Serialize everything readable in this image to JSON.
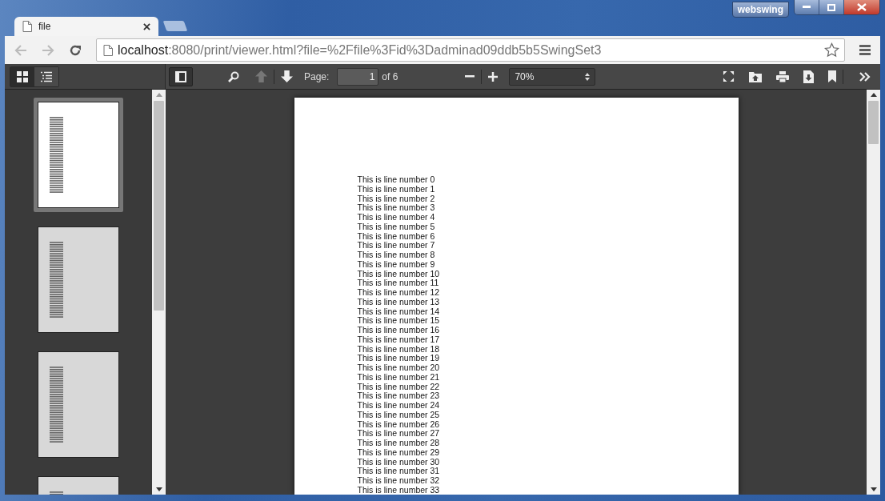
{
  "browser": {
    "tab_title": "file",
    "url_host": "localhost",
    "url_rest": ":8080/print/viewer.html?file=%2Ffile%3Fid%3Dadminad09ddb5b5SwingSet3",
    "user_badge": "webswing"
  },
  "sidebar_views": [
    {
      "kind": "thumbnails",
      "selected": true
    },
    {
      "kind": "outline",
      "selected": false
    }
  ],
  "toolbar": {
    "prev_disabled": true,
    "next_disabled": false,
    "page_label": "Page:",
    "page_value": "1",
    "page_count": "of 6",
    "zoom": "70%"
  },
  "thumbnails": [
    {
      "selected": true
    },
    {
      "selected": false
    },
    {
      "selected": false
    },
    {
      "selected": false
    }
  ],
  "page_lines": [
    "This is line number 0",
    "This is line number 1",
    "This is line number 2",
    "This is line number 3",
    "This is line number 4",
    "This is line number 5",
    "This is line number 6",
    "This is line number 7",
    "This is line number 8",
    "This is line number 9",
    "This is line number 10",
    "This is line number 11",
    "This is line number 12",
    "This is line number 13",
    "This is line number 14",
    "This is line number 15",
    "This is line number 16",
    "This is line number 17",
    "This is line number 18",
    "This is line number 19",
    "This is line number 20",
    "This is line number 21",
    "This is line number 22",
    "This is line number 23",
    "This is line number 24",
    "This is line number 25",
    "This is line number 26",
    "This is line number 27",
    "This is line number 28",
    "This is line number 29",
    "This is line number 30",
    "This is line number 31",
    "This is line number 32",
    "This is line number 33"
  ]
}
